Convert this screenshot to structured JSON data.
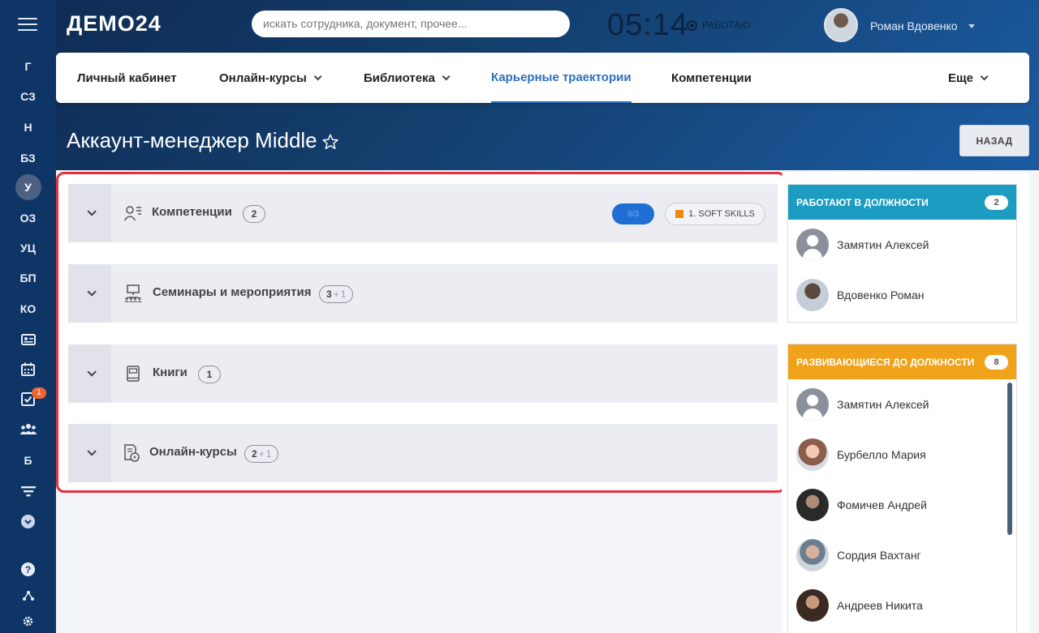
{
  "app": {
    "logo": "ДЕМО24"
  },
  "sidebar": {
    "items": [
      "Г",
      "СЗ",
      "Н",
      "БЗ",
      "У",
      "ОЗ",
      "УЦ",
      "БП",
      "КО"
    ],
    "active": "У",
    "icon_items": [
      "id-card-icon",
      "calendar-icon",
      "tasks-icon",
      "team-icon"
    ],
    "tasks_badge": "1",
    "lower_letter": "Б"
  },
  "header": {
    "search_placeholder": "искать сотрудника, документ, прочее...",
    "clock": "05:14",
    "status": "РАБОТАЮ",
    "user_name": "Роман Вдовенко"
  },
  "nav": {
    "tabs": [
      {
        "label": "Личный кабинет",
        "has_caret": false
      },
      {
        "label": "Онлайн-курсы",
        "has_caret": true
      },
      {
        "label": "Библиотека",
        "has_caret": true
      },
      {
        "label": "Карьерные траектории",
        "has_caret": false,
        "active": true
      },
      {
        "label": "Компетенции",
        "has_caret": false
      },
      {
        "label": "Еще",
        "has_caret": true
      }
    ]
  },
  "page": {
    "title": "Аккаунт-менеджер Middle",
    "back_label": "НАЗАД"
  },
  "sections": [
    {
      "label": "Компетенции",
      "count": "2",
      "count_extra": ""
    },
    {
      "label": "Семинары и мероприятия",
      "count": "3",
      "count_extra": "1"
    },
    {
      "label": "Книги",
      "count": "1",
      "count_extra": ""
    },
    {
      "label": "Онлайн-курсы",
      "count": "2",
      "count_extra": "1"
    }
  ],
  "competence_pills": {
    "blue_label": "8/3",
    "skill_label": "1. SOFT SKILLS",
    "skill_color": "#ee8a12"
  },
  "working": {
    "title": "РАБОТАЮТ В ДОЛЖНОСТИ",
    "count": "2",
    "color": "#1c9cc0",
    "people": [
      "Замятин Алексей",
      "Вдовенко Роман"
    ]
  },
  "developing": {
    "title": "РАЗВИВАЮЩИЕСЯ ДО ДОЛЖНОСТИ",
    "count": "8",
    "color": "#f0a31a",
    "people": [
      "Замятин Алексей",
      "Бурбелло Мария",
      "Фомичев Андрей",
      "Сордия Вахтанг",
      "Андреев Никита"
    ]
  },
  "colors": {
    "accent": "#2b6fbf",
    "highlight_border": "#e8303c"
  }
}
